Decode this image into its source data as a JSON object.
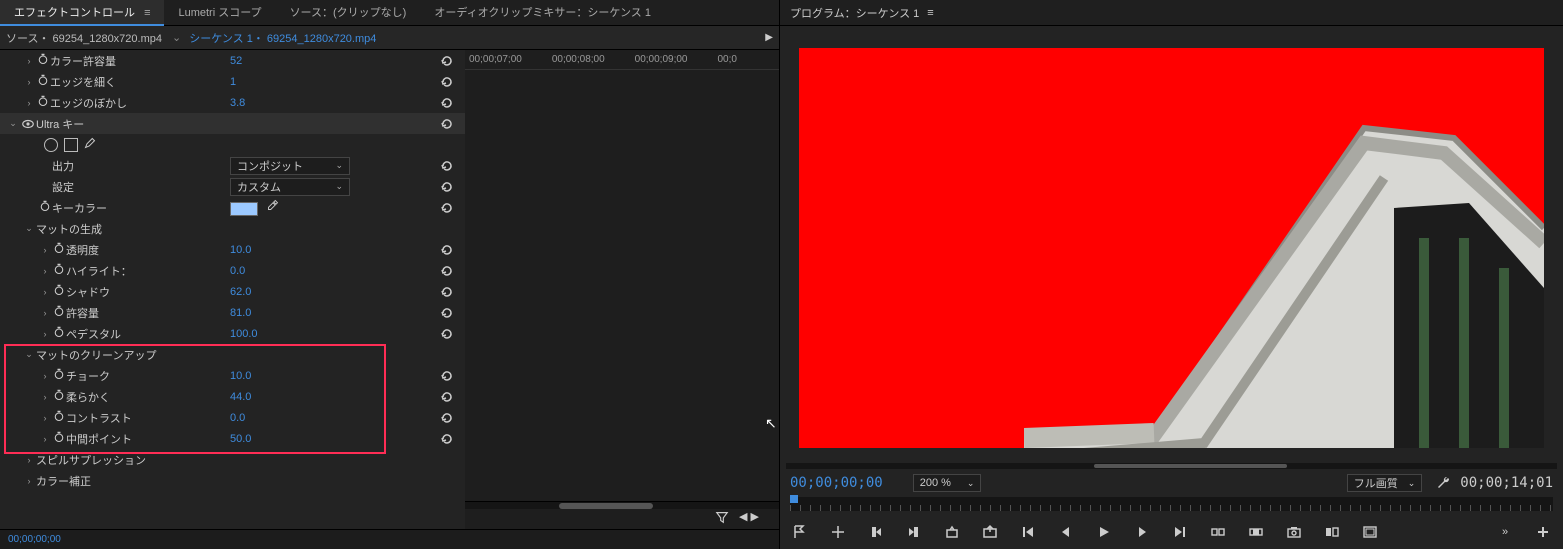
{
  "tabs": {
    "effect_controls": "エフェクトコントロール",
    "lumetri": "Lumetri スコープ",
    "source": "ソース：(クリップなし)",
    "audio_mixer": "オーディオクリップミキサー：シーケンス 1"
  },
  "source_bar": {
    "prefix": "ソース・ 69254_1280x720.mp4",
    "seq": "シーケンス 1・ 69254_1280x720.mp4"
  },
  "ruler": [
    "00;00;07;00",
    "00;00;08;00",
    "00;00;09;00",
    "00;0"
  ],
  "params": {
    "color_tolerance": {
      "label": "カラー許容量",
      "value": "52"
    },
    "edge_thin": {
      "label": "エッジを細く",
      "value": "1"
    },
    "edge_feather": {
      "label": "エッジのぼかし",
      "value": "3.8"
    }
  },
  "ultra": {
    "name": "Ultra キー"
  },
  "ultra_params": {
    "output": {
      "label": "出力",
      "value": "コンポジット"
    },
    "settings": {
      "label": "設定",
      "value": "カスタム"
    },
    "keycolor_label": "キーカラー"
  },
  "matte_gen": {
    "title": "マットの生成",
    "transparency": {
      "label": "透明度",
      "value": "10.0"
    },
    "highlight": {
      "label": "ハイライト：",
      "value": "0.0"
    },
    "shadow": {
      "label": "シャドウ",
      "value": "62.0"
    },
    "tolerance": {
      "label": "許容量",
      "value": "81.0"
    },
    "pedestal": {
      "label": "ペデスタル",
      "value": "100.0"
    }
  },
  "matte_clean": {
    "title": "マットのクリーンアップ",
    "choke": {
      "label": "チョーク",
      "value": "10.0"
    },
    "soften": {
      "label": "柔らかく",
      "value": "44.0"
    },
    "contrast": {
      "label": "コントラスト",
      "value": "0.0"
    },
    "midpoint": {
      "label": "中間ポイント",
      "value": "50.0"
    }
  },
  "spill": {
    "title": "スピルサプレッション"
  },
  "colorcorr": {
    "title": "カラー補正"
  },
  "footer_tc": "00;00;00;00",
  "program": {
    "title": "プログラム：シーケンス 1",
    "current_tc": "00;00;00;00",
    "zoom": "200 %",
    "quality": "フル画質",
    "duration": "00;00;14;01"
  },
  "key_color": "#9cc9ff",
  "red_highlight_box": {
    "top_row": 9,
    "rows": 5
  }
}
